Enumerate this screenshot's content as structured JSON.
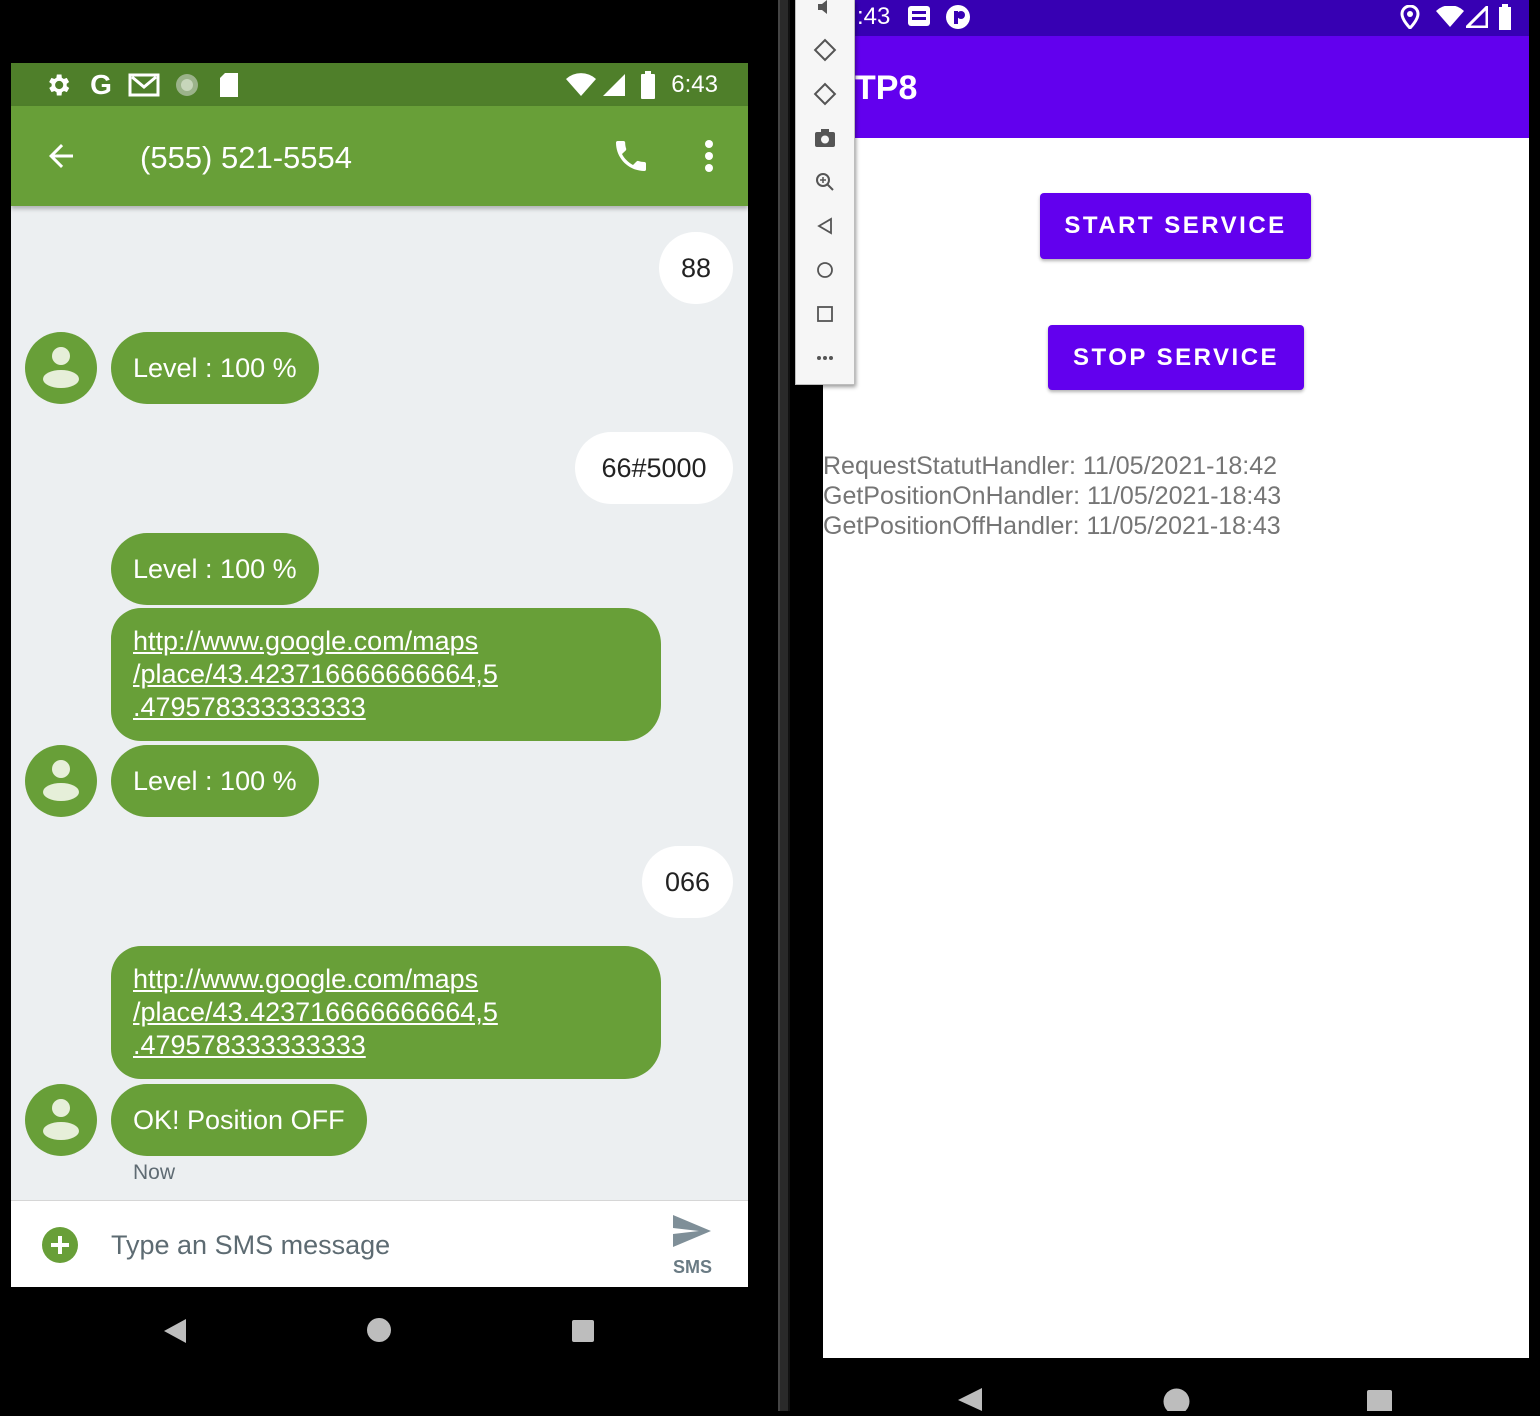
{
  "left_phone": {
    "status_bar": {
      "time": "6:43",
      "icons": [
        "settings-icon",
        "google-icon",
        "gmail-icon",
        "sync-icon",
        "sd-card-icon",
        "wifi-icon",
        "signal-icon",
        "battery-icon"
      ]
    },
    "app_bar": {
      "title": "(555) 521-5554",
      "icons": [
        "back-arrow-icon",
        "phone-icon",
        "more-vert-icon"
      ]
    },
    "messages": [
      {
        "direction": "sent",
        "text": "88"
      },
      {
        "direction": "received",
        "text": "Level : 100 %"
      },
      {
        "direction": "sent",
        "text": "66#5000"
      },
      {
        "direction": "received",
        "text": "Level : 100 %"
      },
      {
        "direction": "received",
        "text": "http://www.google.com/maps\n/place/43.423716666666664,5\n.479578333333333",
        "link": true
      },
      {
        "direction": "received",
        "text": "Level : 100 %"
      },
      {
        "direction": "sent",
        "text": "066"
      },
      {
        "direction": "received",
        "text": "http://www.google.com/maps\n/place/43.423716666666664,5\n.479578333333333",
        "link": true
      },
      {
        "direction": "received",
        "text": "OK! Position OFF"
      }
    ],
    "last_timestamp": "Now",
    "compose": {
      "placeholder": "Type an SMS message",
      "send_label": "SMS"
    },
    "colors": {
      "status_bar": "#4f7f2a",
      "app_bar": "#689f38",
      "chat_bg": "#eceff1"
    }
  },
  "emulator_toolbar": {
    "icons": [
      "volume-icon",
      "rotate-left-icon",
      "rotate-right-icon",
      "camera-icon",
      "zoom-icon",
      "back-icon",
      "home-icon",
      "overview-icon",
      "more-icon"
    ]
  },
  "right_phone": {
    "status_bar": {
      "time": ":43"
    },
    "app_bar": {
      "title": "TP8"
    },
    "buttons": {
      "start": "START SERVICE",
      "stop": "STOP SERVICE"
    },
    "log_lines": [
      "RequestStatutHandler: 11/05/2021-18:42",
      "GetPositionOnHandler: 11/05/2021-18:43",
      "GetPositionOffHandler: 11/05/2021-18:43"
    ],
    "colors": {
      "status_bar": "#3700b3",
      "app_bar": "#6200ee",
      "button": "#6200ee"
    }
  }
}
